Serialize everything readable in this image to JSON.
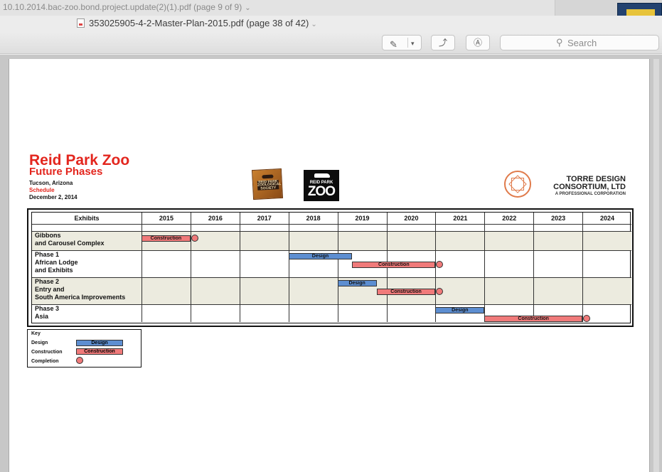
{
  "window": {
    "back_tab_title": "10.10.2014.bac-zoo.bond.project.update(2)(1).pdf (page 9 of 9)",
    "document_title": "353025905-4-2-Master-Plan-2015.pdf (page 38 of 42)",
    "chevron": "⌄"
  },
  "toolbar": {
    "markup_icon": "pen-icon",
    "dropdown_icon": "chevron-down-icon",
    "rotate_icon": "rotate-icon",
    "annotate_icon": "annotate-icon",
    "search_placeholder": "Search"
  },
  "page": {
    "title": "Reid Park Zoo",
    "subtitle": "Future Phases",
    "location": "Tucson, Arizona",
    "label": "Schedule",
    "date": "December 2, 2014",
    "society_logo": "REID PARK ZOOLOGICAL SOCIETY",
    "zoo_logo_small": "REID PARK",
    "zoo_logo_big": "ZOO",
    "firm_line1": "TORRE DESIGN",
    "firm_line2": "CONSORTIUM, LTD",
    "firm_line3": "A PROFESSIONAL CORPORATION"
  },
  "schedule": {
    "exhibits_header": "Exhibits",
    "years": [
      "2015",
      "2016",
      "2017",
      "2018",
      "2019",
      "2020",
      "2021",
      "2022",
      "2023",
      "2024"
    ],
    "rows": [
      {
        "lines": [
          "Gibbons",
          "and Carousel Complex"
        ],
        "shaded": true,
        "construction_label": "Construction",
        "construction": [
          2015.0,
          2016.0
        ],
        "completion": 2016.0
      },
      {
        "lines": [
          "Phase 1",
          "African Lodge",
          "and Exhibits"
        ],
        "shaded": false,
        "design_label": "Design",
        "design": [
          2018.0,
          2019.3
        ],
        "construction_label": "Construction",
        "construction": [
          2019.3,
          2021.0
        ],
        "completion": 2021.0
      },
      {
        "lines": [
          "Phase 2",
          "Entry and",
          "South America Improvements"
        ],
        "shaded": true,
        "design_label": "Design",
        "design": [
          2019.0,
          2019.8
        ],
        "construction_label": "Construction",
        "construction": [
          2019.8,
          2021.0
        ],
        "completion": 2021.0
      },
      {
        "lines": [
          "Phase 3",
          "Asia"
        ],
        "shaded": false,
        "design_label": "Design",
        "design": [
          2021.0,
          2022.0
        ],
        "construction_label": "Construction",
        "construction": [
          2022.0,
          2024.0
        ],
        "completion": 2024.0
      }
    ]
  },
  "key": {
    "title": "Key",
    "design_label": "Design",
    "construction_label": "Construction",
    "completion_label": "Completion",
    "design_bar_text": "Design",
    "construction_bar_text": "Construction"
  },
  "colors": {
    "title_red": "#e3261e",
    "design_blue": "#5d8ed1",
    "construction_red": "#f07a7a",
    "row_shade": "#ecebdf"
  }
}
